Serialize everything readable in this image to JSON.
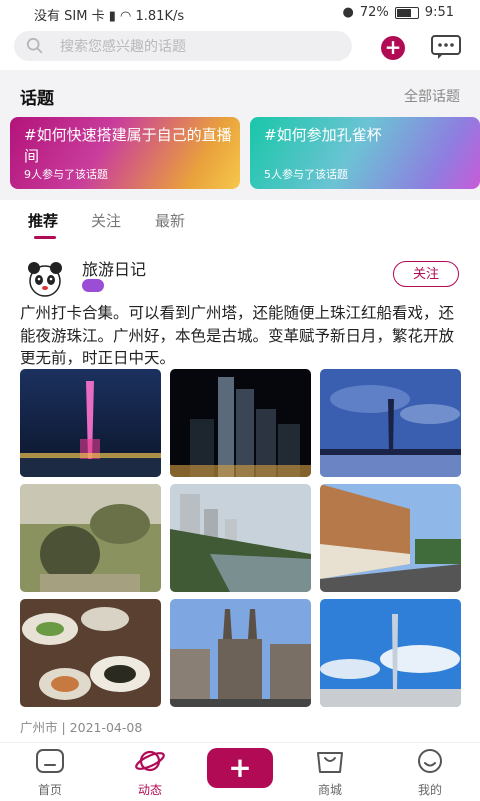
{
  "status_bar": {
    "carrier": "没有 SIM 卡",
    "speed": "1.81K/s",
    "battery": "72%",
    "time": "9:51"
  },
  "header": {
    "search_placeholder": "搜索您感兴趣的话题"
  },
  "topics": {
    "title": "话题",
    "all_label": "全部话题",
    "items": [
      {
        "title": "#如何快速搭建属于自己的直播间",
        "participants": "9人参与了该话题"
      },
      {
        "title": "#如何参加孔雀杯",
        "participants": "5人参与了该话题"
      }
    ]
  },
  "tabs": [
    {
      "label": "推荐"
    },
    {
      "label": "关注"
    },
    {
      "label": "最新"
    }
  ],
  "post": {
    "author": "旅游日记",
    "follow_label": "关注",
    "text": "广州打卡合集。可以看到广州塔，还能随便上珠江红船看戏，还能夜游珠江。广州好，本色是古城。变革赋予新日月，繁花开放更无前，时正日中天。",
    "location_date": "广州市 | 2021-04-08"
  },
  "bottom_nav": [
    {
      "label": "首页"
    },
    {
      "label": "动态"
    },
    {
      "label": "商城"
    },
    {
      "label": "我的"
    }
  ],
  "center_add_label": "+",
  "colors": {
    "accent": "#b10b55"
  }
}
